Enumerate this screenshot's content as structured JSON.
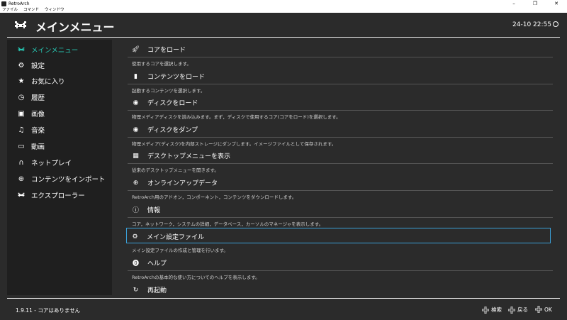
{
  "window": {
    "title": "RetroArch",
    "controls": [
      "–",
      "❐",
      "✕"
    ]
  },
  "menubar": [
    "ファイル",
    "コマンド",
    "ウィンドウ"
  ],
  "header": {
    "title": "メインメニュー",
    "clock": "24-10 22:55"
  },
  "sidebar": {
    "items": [
      {
        "label": "メインメニュー",
        "icon": "retroarch-invader-icon",
        "active": true
      },
      {
        "label": "設定",
        "icon": "gear-icon"
      },
      {
        "label": "お気に入り",
        "icon": "star-icon"
      },
      {
        "label": "履歴",
        "icon": "history-icon"
      },
      {
        "label": "画像",
        "icon": "image-icon"
      },
      {
        "label": "音楽",
        "icon": "music-icon"
      },
      {
        "label": "動画",
        "icon": "video-icon"
      },
      {
        "label": "ネットプレイ",
        "icon": "headset-icon"
      },
      {
        "label": "コンテンツをインポート",
        "icon": "plus-circle-icon"
      },
      {
        "label": "エクスプローラー",
        "icon": "retroarch-invader-icon"
      }
    ]
  },
  "main": {
    "entries": [
      {
        "label": "コアをロード",
        "desc": "使用するコアを選択します。",
        "icon": "rocket-icon"
      },
      {
        "label": "コンテンツをロード",
        "desc": "起動するコンテンツを選択します。",
        "icon": "file-icon"
      },
      {
        "label": "ディスクをロード",
        "desc": "物理メディアディスクを読み込みます。まず，ディスクで使用するコア(コアをロード)を選択します。",
        "icon": "disc-icon"
      },
      {
        "label": "ディスクをダンプ",
        "desc": "物理メディア(ディスク)を内部ストレージにダンプします。イメージファイルとして保存されます。",
        "icon": "disc-icon"
      },
      {
        "label": "デスクトップメニューを表示",
        "desc": "従来のデスクトップメニューを開きます。",
        "icon": "desktop-menu-icon"
      },
      {
        "label": "オンラインアップデータ",
        "desc": "RetroArch用のアドオン，コンポーネント，コンテンツをダウンロードします。",
        "icon": "globe-icon"
      },
      {
        "label": "情報",
        "desc": "コア，ネットワーク，システムの詳細，データベース，カーソルのマネージャを表示します。",
        "icon": "info-icon"
      },
      {
        "label": "メイン設定ファイル",
        "desc": "メイン設定ファイルの作成と管理を行います。",
        "icon": "config-gears-icon",
        "selected": true
      },
      {
        "label": "ヘルプ",
        "desc": "RetroArchの基本的な使い方についてのヘルプを表示します。",
        "icon": "help-icon"
      },
      {
        "label": "再起動",
        "desc": "",
        "icon": "restart-icon"
      }
    ]
  },
  "footer": {
    "status": "1.9.11 - コアはありません",
    "hints": [
      {
        "label": "検索",
        "icon": "dpad-icon"
      },
      {
        "label": "戻る",
        "icon": "dpad-icon"
      },
      {
        "label": "OK",
        "icon": "dpad-icon"
      }
    ]
  }
}
